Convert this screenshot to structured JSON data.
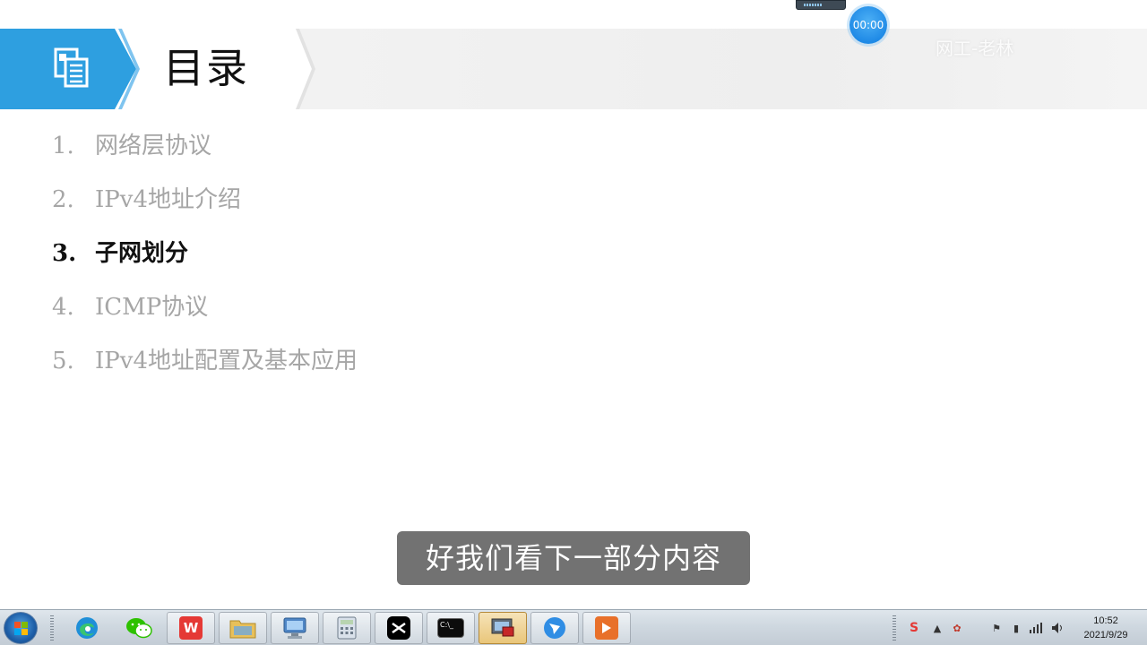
{
  "slide": {
    "title": "目录",
    "watermark": "网工-老林",
    "agenda": [
      {
        "num": "1.",
        "text": "网络层协议",
        "active": false
      },
      {
        "num": "2.",
        "text": "IPv4地址介绍",
        "active": false
      },
      {
        "num": "3.",
        "text": "子网划分",
        "active": true
      },
      {
        "num": "4.",
        "text": "ICMP协议",
        "active": false
      },
      {
        "num": "5.",
        "text": "IPv4地址配置及基本应用",
        "active": false
      }
    ]
  },
  "overlay": {
    "timer": "00:00",
    "subtitle": "好我们看下一部分内容"
  },
  "taskbar": {
    "apps": [
      {
        "name": "edge-browser"
      },
      {
        "name": "wechat"
      },
      {
        "name": "wps-office"
      },
      {
        "name": "file-explorer"
      },
      {
        "name": "network-settings"
      },
      {
        "name": "calculator"
      },
      {
        "name": "capcut"
      },
      {
        "name": "command-prompt",
        "label": "C:\\_"
      },
      {
        "name": "remote-desktop"
      },
      {
        "name": "feishu"
      },
      {
        "name": "powerpoint-player"
      }
    ],
    "clock": {
      "time": "10:52",
      "date": "2021/9/29"
    }
  },
  "colors": {
    "header_blue": "#2e9fe0",
    "active_text": "#111111",
    "inactive_text": "#a6a6a6"
  }
}
